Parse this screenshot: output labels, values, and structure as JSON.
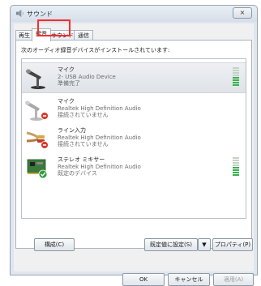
{
  "window": {
    "title": "サウンド",
    "close_label": "×"
  },
  "tabs": [
    {
      "label": "再生"
    },
    {
      "label": "録音"
    },
    {
      "label": "サウンド"
    },
    {
      "label": "通信"
    }
  ],
  "instruction": "次のオーディオ録音デバイスがインストールされています:",
  "devices": [
    {
      "name": "マイク",
      "sub": "2- USB Audio Device",
      "status": "準備完了",
      "icon": "microphone-icon",
      "level_on": 4
    },
    {
      "name": "マイク",
      "sub": "Realtek High Definition Audio",
      "status": "接続されていません",
      "icon": "microphone-disconnected-icon",
      "level_on": 0
    },
    {
      "name": "ライン入力",
      "sub": "Realtek High Definition Audio",
      "status": "接続されていません",
      "icon": "line-in-cable-icon",
      "level_on": 0
    },
    {
      "name": "ステレオ ミキサー",
      "sub": "Realtek High Definition Audio",
      "status": "既定のデバイス",
      "icon": "sound-card-icon",
      "level_on": 4
    }
  ],
  "buttons": {
    "configure": "構成(C)",
    "set_default": "既定値に設定(S)",
    "dropdown_arrow": "▼",
    "properties": "プロパティ(P)",
    "ok": "OK",
    "cancel": "キャンセル",
    "apply": "適用(A)"
  },
  "colors": {
    "highlight": "#ff2b2b",
    "level_on": "#37b24d",
    "level_off": "#c5d3c7"
  }
}
